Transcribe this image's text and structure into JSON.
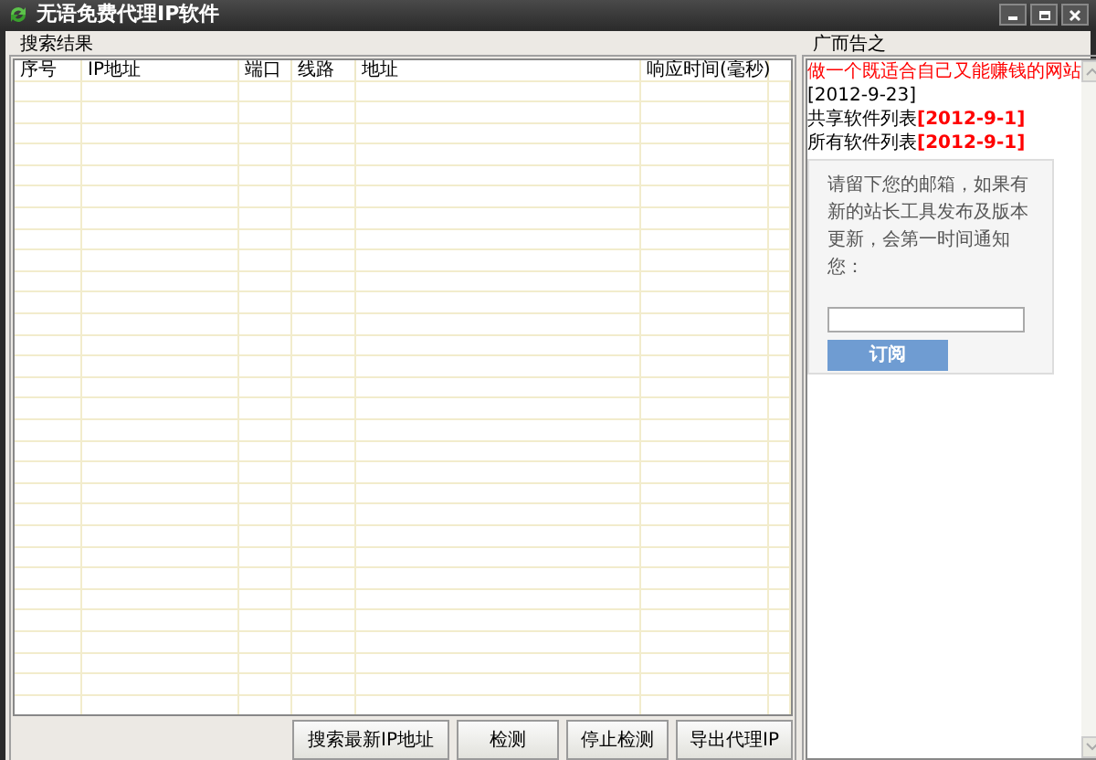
{
  "window": {
    "title": "无语免费代理IP软件"
  },
  "search_results": {
    "title": "搜索结果",
    "columns": [
      "序号",
      "IP地址",
      "端口",
      "线路",
      "地址",
      "响应时间(毫秒)"
    ]
  },
  "buttons": [
    "搜索最新IP地址",
    "检测",
    "停止检测",
    "导出代理IP"
  ],
  "ads": {
    "title": "广而告之",
    "items": [
      {
        "kind": "headline",
        "label": "做一个既适合自己又能赚钱的网站"
      },
      {
        "kind": "date",
        "label": "[2012-9-23]"
      },
      {
        "kind": "list",
        "label": "共享软件列表",
        "date": "[2012-9-1]"
      },
      {
        "kind": "list",
        "label": "所有软件列表",
        "date": "[2012-9-1]"
      }
    ],
    "subscribe": {
      "message": "请留下您的邮箱，如果有新的站长工具发布及版本更新，会第一时间通知您：",
      "button": "订阅"
    }
  }
}
